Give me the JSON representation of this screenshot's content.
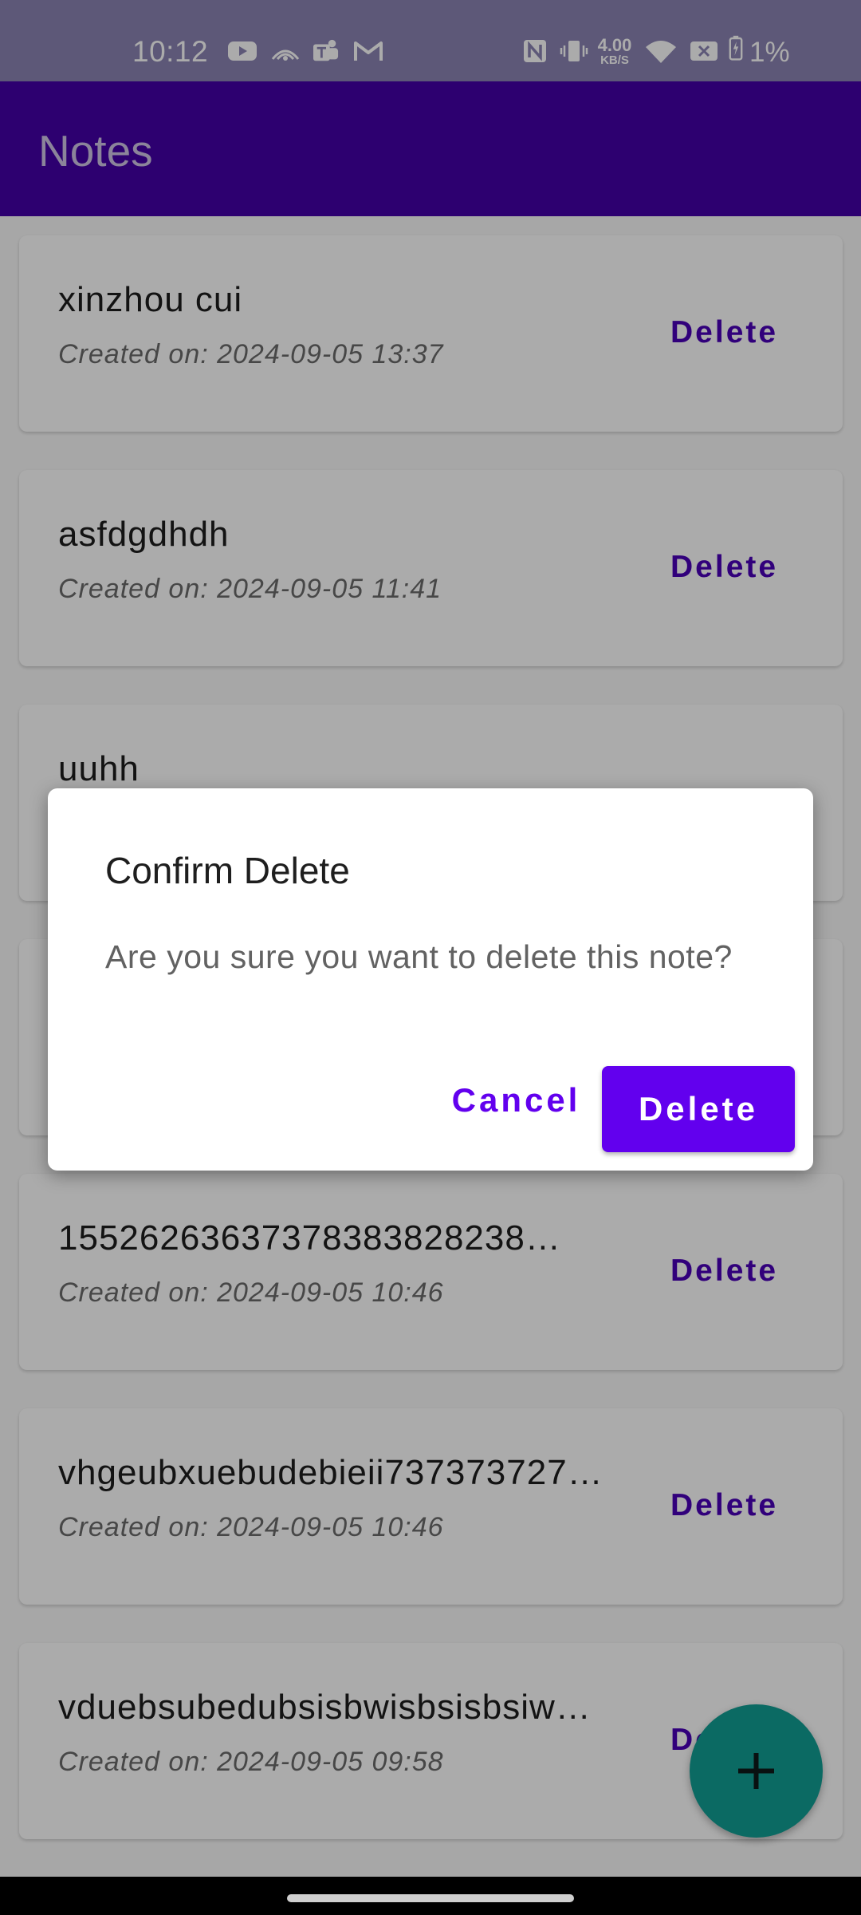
{
  "status_bar": {
    "time": "10:12",
    "net_speed_value": "4.00",
    "net_speed_unit": "KB/S",
    "battery": "1%",
    "left_icons": [
      "youtube-icon",
      "broadcast-icon",
      "teams-icon",
      "gmail-icon"
    ],
    "right_icons": [
      "nfc-icon",
      "vibrate-icon",
      "wifi-icon",
      "sim-off-icon",
      "battery-charging-icon"
    ]
  },
  "app_bar": {
    "title": "Notes"
  },
  "notes": [
    {
      "title": "xinzhou cui",
      "date": "Created on: 2024-09-05 13:37",
      "delete_label": "Delete"
    },
    {
      "title": "asfdgdhdh",
      "date": "Created on: 2024-09-05 11:41",
      "delete_label": "Delete"
    },
    {
      "title": "uuhh",
      "date": "",
      "delete_label": ""
    },
    {
      "title": "",
      "date": "",
      "delete_label": ""
    },
    {
      "title": "15526263637378383828238…",
      "date": "Created on: 2024-09-05 10:46",
      "delete_label": "Delete"
    },
    {
      "title": "vhgeubxuebudebieii737373727…",
      "date": "Created on: 2024-09-05 10:46",
      "delete_label": "Delete"
    },
    {
      "title": "vduebsubedubsisbwisbsisbsiw…",
      "date": "Created on: 2024-09-05 09:58",
      "delete_label": "Delete"
    }
  ],
  "dialog": {
    "title": "Confirm Delete",
    "message": "Are you sure you want to delete this note?",
    "cancel_label": "Cancel",
    "confirm_label": "Delete"
  },
  "fab": {
    "icon": "plus-icon"
  },
  "colors": {
    "app_bar": "#4300a7",
    "status_bar": "#8b84b4",
    "accent": "#6200ee",
    "fab": "#119e94"
  }
}
